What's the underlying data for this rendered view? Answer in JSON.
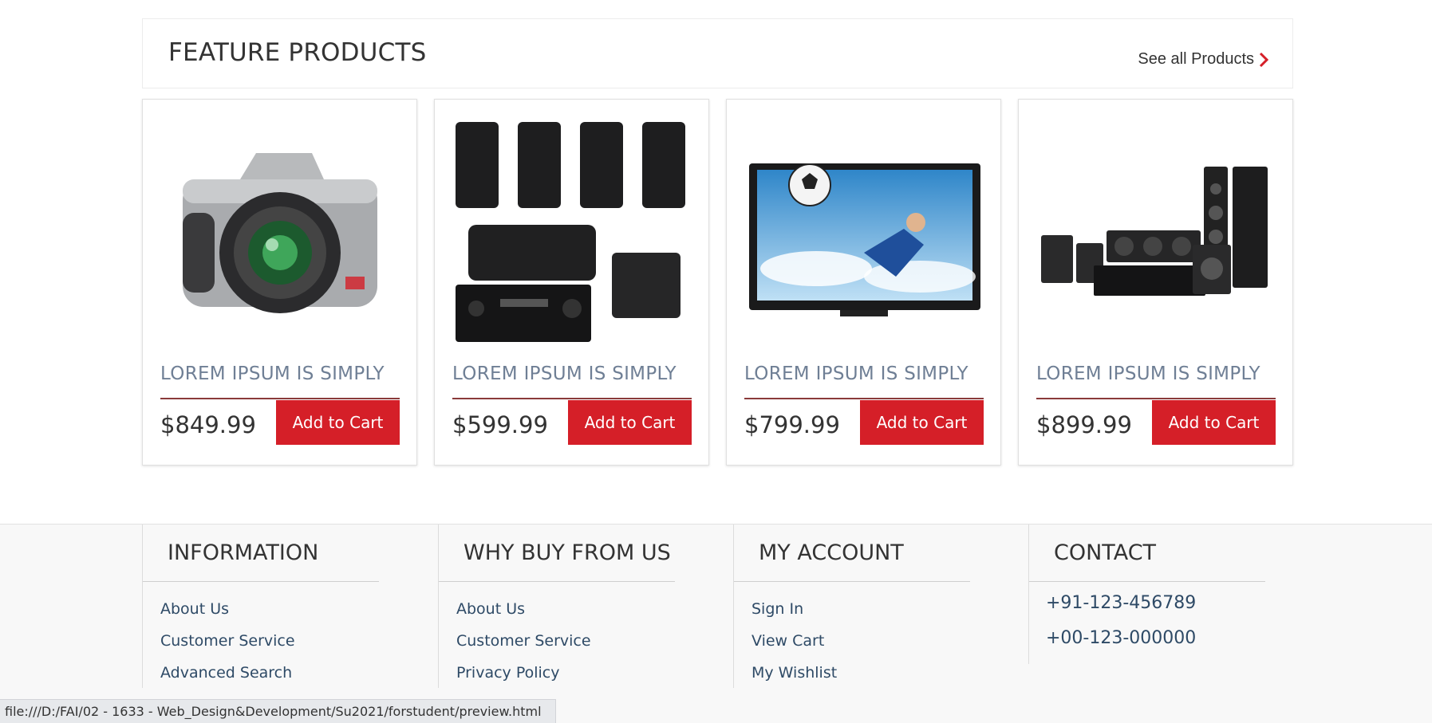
{
  "feature": {
    "title": "FEATURE PRODUCTS",
    "see_all": "See all Products"
  },
  "products": [
    {
      "name": "LOREM IPSUM IS SIMPLY",
      "price": "$849.99",
      "cart_label": "Add to Cart",
      "image": "camera"
    },
    {
      "name": "LOREM IPSUM IS SIMPLY",
      "price": "$599.99",
      "cart_label": "Add to Cart",
      "image": "speakers"
    },
    {
      "name": "LOREM IPSUM IS SIMPLY",
      "price": "$799.99",
      "cart_label": "Add to Cart",
      "image": "television"
    },
    {
      "name": "LOREM IPSUM IS SIMPLY",
      "price": "$899.99",
      "cart_label": "Add to Cart",
      "image": "home-theater"
    }
  ],
  "footer": {
    "information": {
      "title": "INFORMATION",
      "links": [
        "About Us",
        "Customer Service",
        "Advanced Search"
      ]
    },
    "why_buy": {
      "title": "WHY BUY FROM US",
      "links": [
        "About Us",
        "Customer Service",
        "Privacy Policy"
      ]
    },
    "account": {
      "title": "MY ACCOUNT",
      "links": [
        "Sign In",
        "View Cart",
        "My Wishlist"
      ]
    },
    "contact": {
      "title": "CONTACT",
      "phones": [
        "+91-123-456789",
        "+00-123-000000"
      ]
    }
  },
  "status_bar": {
    "url": "file:///D:/FAI/02 - 1633 - Web_Design&Development/Su2021/forstudent/preview.html"
  },
  "colors": {
    "accent": "#d51f28",
    "product_name": "#6f7f95",
    "link": "#2e4a66"
  }
}
